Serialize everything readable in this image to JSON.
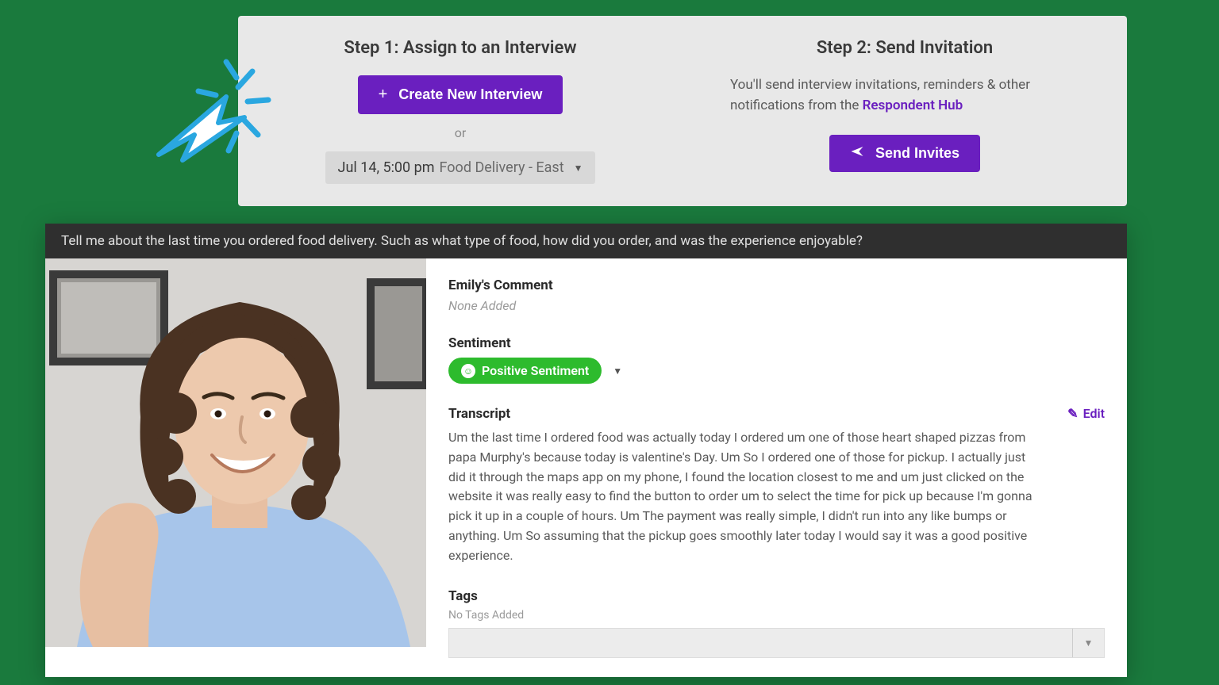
{
  "steps": {
    "step1": {
      "title": "Step 1: Assign to an Interview",
      "create_btn": "Create New Interview",
      "or": "or",
      "dropdown_date": "Jul 14, 5:00 pm",
      "dropdown_label": "Food Delivery - East"
    },
    "step2": {
      "title": "Step 2: Send Invitation",
      "desc_prefix": "You'll send interview invitations, reminders & other notifications from the ",
      "desc_link": "Respondent Hub",
      "send_btn": "Send Invites"
    }
  },
  "interview": {
    "question": "Tell me about the last time you ordered food delivery. Such as what type of food, how did you order, and was the experience enjoyable?",
    "comment_title": "Emily's Comment",
    "comment_value": "None Added",
    "sentiment_title": "Sentiment",
    "sentiment_value": "Positive Sentiment",
    "transcript_title": "Transcript",
    "edit_label": "Edit",
    "transcript_text": "Um the last time I ordered food was actually today I ordered um one of those heart shaped pizzas from papa Murphy's because today is valentine's Day. Um So I ordered one of those for pickup. I actually just did it through the maps app on my phone, I found the location closest to me and um just clicked on the website it was really easy to find the button to order um to select the time for pick up because I'm gonna pick it up in a couple of hours. Um The payment was really simple, I didn't run into any like bumps or anything. Um So assuming that the pickup goes smoothly later today I would say it was a good positive experience.",
    "tags_title": "Tags",
    "tags_empty": "No Tags Added"
  },
  "colors": {
    "primary": "#6a1fbf",
    "positive": "#2dbb2d"
  }
}
